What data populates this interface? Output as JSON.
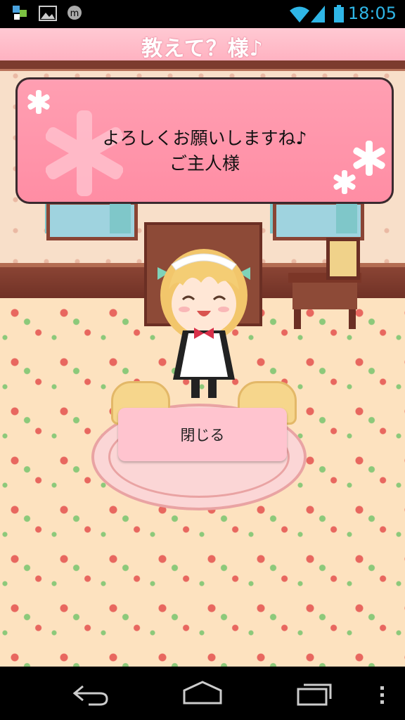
{
  "status_bar": {
    "time": "18:05",
    "left_icons": [
      "app-notification-icon",
      "image-notification-icon",
      "messenger-notification-icon"
    ],
    "right_icons": [
      "wifi-icon",
      "signal-icon",
      "battery-icon"
    ],
    "accent_color": "#2fb6e6"
  },
  "header": {
    "title": "教えて？様♪",
    "color": "#ffb8c6"
  },
  "dialog": {
    "line1": "よろしくお願いしますね♪",
    "line2": "ご主人様",
    "close_label": "閉じる",
    "bubble_color": "#ff97ad",
    "button_color": "#ffc4cf"
  },
  "nav_bar": {
    "buttons": [
      "back-icon",
      "home-icon",
      "recent-apps-icon",
      "overflow-menu-icon"
    ]
  }
}
